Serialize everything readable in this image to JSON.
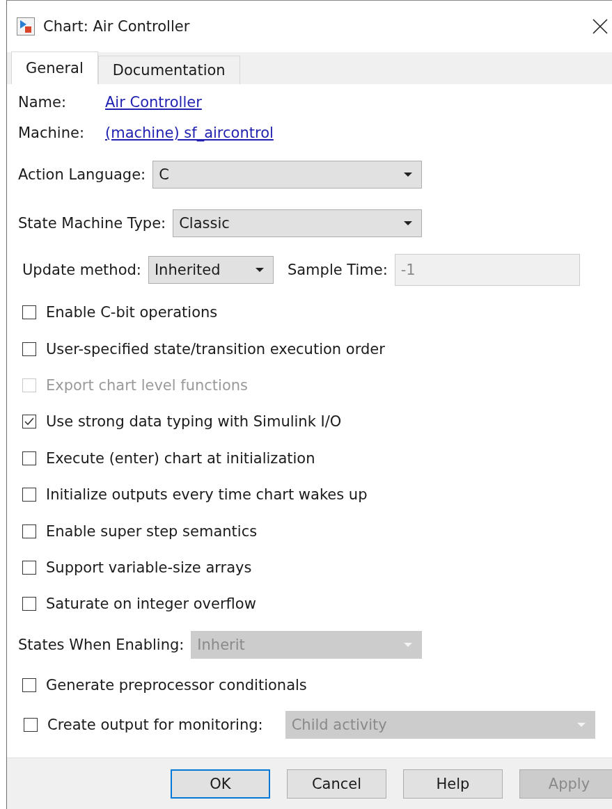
{
  "window": {
    "title": "Chart: Air Controller"
  },
  "tabs": [
    {
      "label": "General",
      "selected": true
    },
    {
      "label": "Documentation",
      "selected": false
    }
  ],
  "rows": [
    {
      "kind": "link",
      "label": "Name:",
      "value": "Air Controller"
    },
    {
      "kind": "link",
      "label": "Machine:",
      "value": "(machine) sf_aircontrol"
    },
    {
      "kind": "dropdown",
      "label": "Action Language:",
      "value": "C",
      "disabled": false
    },
    {
      "kind": "dropdown",
      "label": "State Machine Type:",
      "value": "Classic",
      "disabled": false
    },
    {
      "kind": "update",
      "label": "Update method:",
      "value": "Inherited",
      "field_label": "Sample Time:",
      "field_value": "-1",
      "field_disabled": true
    },
    {
      "kind": "checkbox",
      "label": "Enable C-bit operations",
      "checked": false,
      "disabled": false
    },
    {
      "kind": "checkbox",
      "label": "User-specified state/transition execution order",
      "checked": false,
      "disabled": false
    },
    {
      "kind": "checkbox",
      "label": "Export chart level functions",
      "checked": false,
      "disabled": true
    },
    {
      "kind": "checkbox",
      "label": "Use strong data typing with Simulink I/O",
      "checked": true,
      "disabled": false
    },
    {
      "kind": "checkbox",
      "label": "Execute (enter) chart at initialization",
      "checked": false,
      "disabled": false
    },
    {
      "kind": "checkbox",
      "label": "Initialize outputs every time chart wakes up",
      "checked": false,
      "disabled": false
    },
    {
      "kind": "checkbox",
      "label": "Enable super step semantics",
      "checked": false,
      "disabled": false
    },
    {
      "kind": "checkbox",
      "label": "Support variable-size arrays",
      "checked": false,
      "disabled": false
    },
    {
      "kind": "checkbox",
      "label": "Saturate on integer overflow",
      "checked": false,
      "disabled": false
    },
    {
      "kind": "dropdown",
      "label": "States When Enabling:",
      "value": "Inherit",
      "disabled": true
    },
    {
      "kind": "checkbox",
      "label": "Generate preprocessor conditionals",
      "checked": false,
      "disabled": false
    },
    {
      "kind": "monitor",
      "label": "Create output for monitoring:",
      "checked": false,
      "value": "Child activity",
      "disabled": true
    }
  ],
  "buttons": [
    {
      "label": "OK",
      "default": true,
      "disabled": false
    },
    {
      "label": "Cancel",
      "default": false,
      "disabled": false
    },
    {
      "label": "Help",
      "default": false,
      "disabled": false
    },
    {
      "label": "Apply",
      "default": false,
      "disabled": true
    }
  ]
}
